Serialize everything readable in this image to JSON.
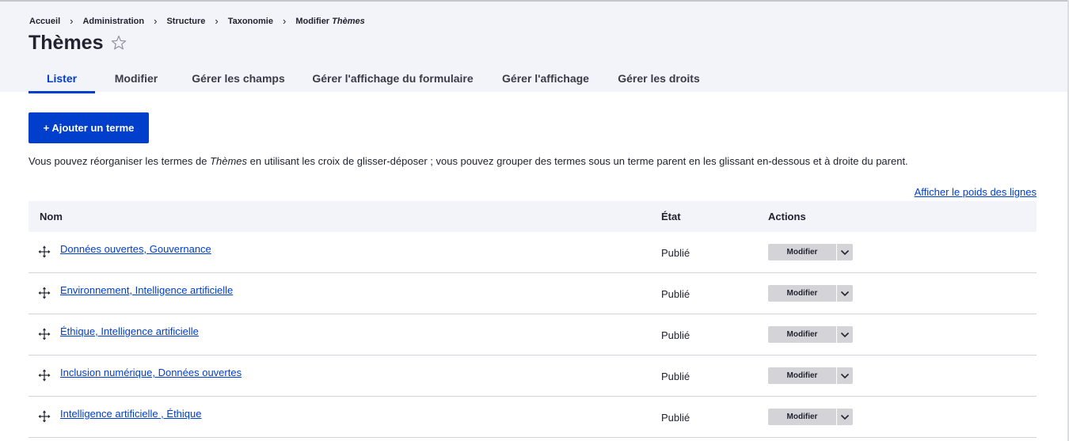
{
  "breadcrumb": {
    "items": [
      "Accueil",
      "Administration",
      "Structure",
      "Taxonomie"
    ],
    "last_prefix": "Modifier",
    "last_emphasis": "Thèmes",
    "separator": "›"
  },
  "page": {
    "title": "Thèmes"
  },
  "tabs": [
    {
      "label": "Lister",
      "active": true
    },
    {
      "label": "Modifier",
      "active": false
    },
    {
      "label": "Gérer les champs",
      "active": false
    },
    {
      "label": "Gérer l'affichage du formulaire",
      "active": false
    },
    {
      "label": "Gérer l'affichage",
      "active": false
    },
    {
      "label": "Gérer les droits",
      "active": false
    }
  ],
  "actions": {
    "add_term_label": "+ Ajouter un terme"
  },
  "help": {
    "before": "Vous pouvez réorganiser les termes de ",
    "emphasis": "Thèmes",
    "after": " en utilisant les croix de glisser-déposer ; vous pouvez grouper des termes sous un terme parent en les glissant en-dessous et à droite du parent."
  },
  "weights_link": "Afficher le poids des lignes",
  "table": {
    "columns": [
      "Nom",
      "État",
      "Actions"
    ],
    "rows": [
      {
        "name": "Données ouvertes, Gouvernance",
        "state": "Publié",
        "action": "Modifier"
      },
      {
        "name": "Environnement, Intelligence artificielle",
        "state": "Publié",
        "action": "Modifier"
      },
      {
        "name": "Éthique, Intelligence artificielle",
        "state": "Publié",
        "action": "Modifier"
      },
      {
        "name": "Inclusion numérique, Données ouvertes",
        "state": "Publié",
        "action": "Modifier"
      },
      {
        "name": "Intelligence artificielle , Éthique",
        "state": "Publié",
        "action": "Modifier"
      }
    ]
  },
  "colors": {
    "accent": "#003ecc",
    "header_bg": "#f3f4f9",
    "text": "#222330",
    "dropbutton_bg": "#d4d4d8"
  },
  "icons": {
    "favorite": "star-outline-icon",
    "drag": "drag-handle-icon",
    "dropdown": "chevron-down-icon"
  }
}
